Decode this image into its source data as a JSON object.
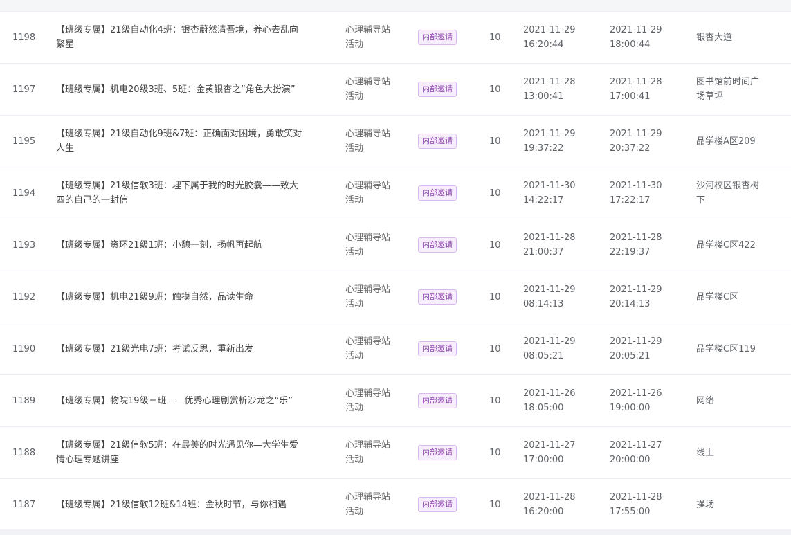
{
  "rows": [
    {
      "id": "1198",
      "title": [
        "【班级专属】21级自动化4班：银杏蔚然清吾境，养心去乱向",
        "繁星"
      ],
      "type": [
        "心理辅导站",
        "活动"
      ],
      "tag": "内部邀请",
      "count": "10",
      "start": [
        "2021-11-29",
        "16:20:44"
      ],
      "end": [
        "2021-11-29",
        "18:00:44"
      ],
      "place": [
        "银杏大道"
      ]
    },
    {
      "id": "1197",
      "title": [
        "【班级专属】机电20级3班、5班：金黄银杏之“角色大扮演”"
      ],
      "type": [
        "心理辅导站",
        "活动"
      ],
      "tag": "内部邀请",
      "count": "10",
      "start": [
        "2021-11-28",
        "13:00:41"
      ],
      "end": [
        "2021-11-28",
        "17:00:41"
      ],
      "place": [
        "图书馆前时间广",
        "场草坪"
      ]
    },
    {
      "id": "1195",
      "title": [
        "【班级专属】21级自动化9班&7班：正确面对困境，勇敢笑对",
        "人生"
      ],
      "type": [
        "心理辅导站",
        "活动"
      ],
      "tag": "内部邀请",
      "count": "10",
      "start": [
        "2021-11-29",
        "19:37:22"
      ],
      "end": [
        "2021-11-29",
        "20:37:22"
      ],
      "place": [
        "品学楼A区209"
      ]
    },
    {
      "id": "1194",
      "title": [
        "【班级专属】21级信软3班：埋下属于我的时光胶囊——致大",
        "四的自己的一封信"
      ],
      "type": [
        "心理辅导站",
        "活动"
      ],
      "tag": "内部邀请",
      "count": "10",
      "start": [
        "2021-11-30",
        "14:22:17"
      ],
      "end": [
        "2021-11-30",
        "17:22:17"
      ],
      "place": [
        "沙河校区银杏树",
        "下"
      ]
    },
    {
      "id": "1193",
      "title": [
        "【班级专属】资环21级1班：小憩一刻，扬帆再起航"
      ],
      "type": [
        "心理辅导站",
        "活动"
      ],
      "tag": "内部邀请",
      "count": "10",
      "start": [
        "2021-11-28",
        "21:00:37"
      ],
      "end": [
        "2021-11-28",
        "22:19:37"
      ],
      "place": [
        "品学楼C区422"
      ]
    },
    {
      "id": "1192",
      "title": [
        "【班级专属】机电21级9班：触摸自然，品读生命"
      ],
      "type": [
        "心理辅导站",
        "活动"
      ],
      "tag": "内部邀请",
      "count": "10",
      "start": [
        "2021-11-29",
        "08:14:13"
      ],
      "end": [
        "2021-11-29",
        "20:14:13"
      ],
      "place": [
        "品学楼C区"
      ]
    },
    {
      "id": "1190",
      "title": [
        "【班级专属】21级光电7班：考试反思，重新出发"
      ],
      "type": [
        "心理辅导站",
        "活动"
      ],
      "tag": "内部邀请",
      "count": "10",
      "start": [
        "2021-11-29",
        "08:05:21"
      ],
      "end": [
        "2021-11-29",
        "20:05:21"
      ],
      "place": [
        "品学楼C区119"
      ]
    },
    {
      "id": "1189",
      "title": [
        "【班级专属】物院19级三班——优秀心理剧赏析沙龙之“乐”"
      ],
      "type": [
        "心理辅导站",
        "活动"
      ],
      "tag": "内部邀请",
      "count": "10",
      "start": [
        "2021-11-26",
        "18:05:00"
      ],
      "end": [
        "2021-11-26",
        "19:00:00"
      ],
      "place": [
        "网络"
      ]
    },
    {
      "id": "1188",
      "title": [
        "【班级专属】21级信软5班：在最美的时光遇见你—大学生爱",
        "情心理专题讲座"
      ],
      "type": [
        "心理辅导站",
        "活动"
      ],
      "tag": "内部邀请",
      "count": "10",
      "start": [
        "2021-11-27",
        "17:00:00"
      ],
      "end": [
        "2021-11-27",
        "20:00:00"
      ],
      "place": [
        "线上"
      ]
    },
    {
      "id": "1187",
      "title": [
        "【班级专属】21级信软12班&14班：金秋时节，与你相遇"
      ],
      "type": [
        "心理辅导站",
        "活动"
      ],
      "tag": "内部邀请",
      "count": "10",
      "start": [
        "2021-11-28",
        "16:20:00"
      ],
      "end": [
        "2021-11-28",
        "17:55:00"
      ],
      "place": [
        "操场"
      ]
    }
  ]
}
